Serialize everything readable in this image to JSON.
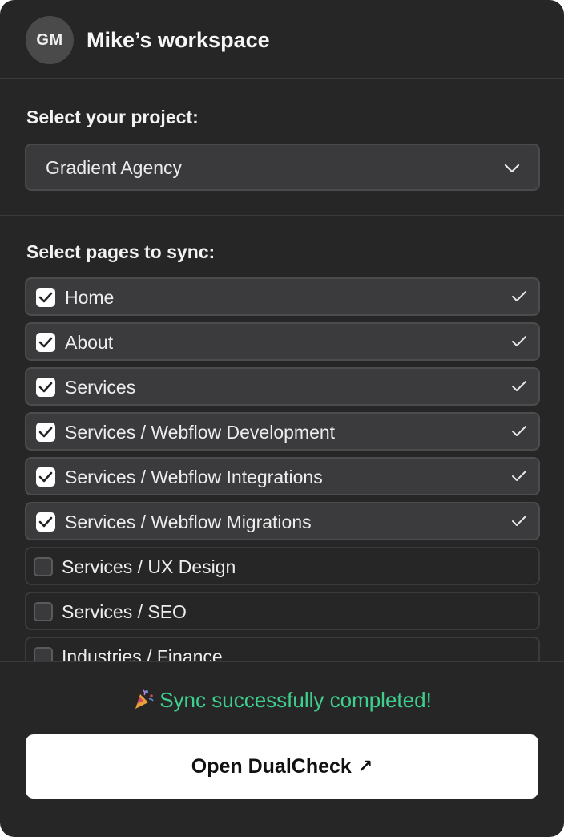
{
  "header": {
    "avatar_initials": "GM",
    "workspace_title": "Mike’s workspace"
  },
  "project": {
    "label": "Select your project:",
    "selected": "Gradient Agency"
  },
  "pages": {
    "label": "Select pages to sync:",
    "items": [
      {
        "label": "Home",
        "checked": true,
        "synced": true
      },
      {
        "label": "About",
        "checked": true,
        "synced": true
      },
      {
        "label": "Services",
        "checked": true,
        "synced": true
      },
      {
        "label": "Services / Webflow Development",
        "checked": true,
        "synced": true
      },
      {
        "label": "Services / Webflow Integrations",
        "checked": true,
        "synced": true
      },
      {
        "label": "Services / Webflow Migrations",
        "checked": true,
        "synced": true
      },
      {
        "label": "Services / UX Design",
        "checked": false,
        "synced": false
      },
      {
        "label": "Services / SEO",
        "checked": false,
        "synced": false
      },
      {
        "label": "Industries / Finance",
        "checked": false,
        "synced": false
      }
    ]
  },
  "status": {
    "icon": "confetti-icon",
    "text": "Sync successfully completed!",
    "color": "#3ecf8e"
  },
  "cta": {
    "label": "Open DualCheck",
    "icon": "external-arrow-icon"
  }
}
